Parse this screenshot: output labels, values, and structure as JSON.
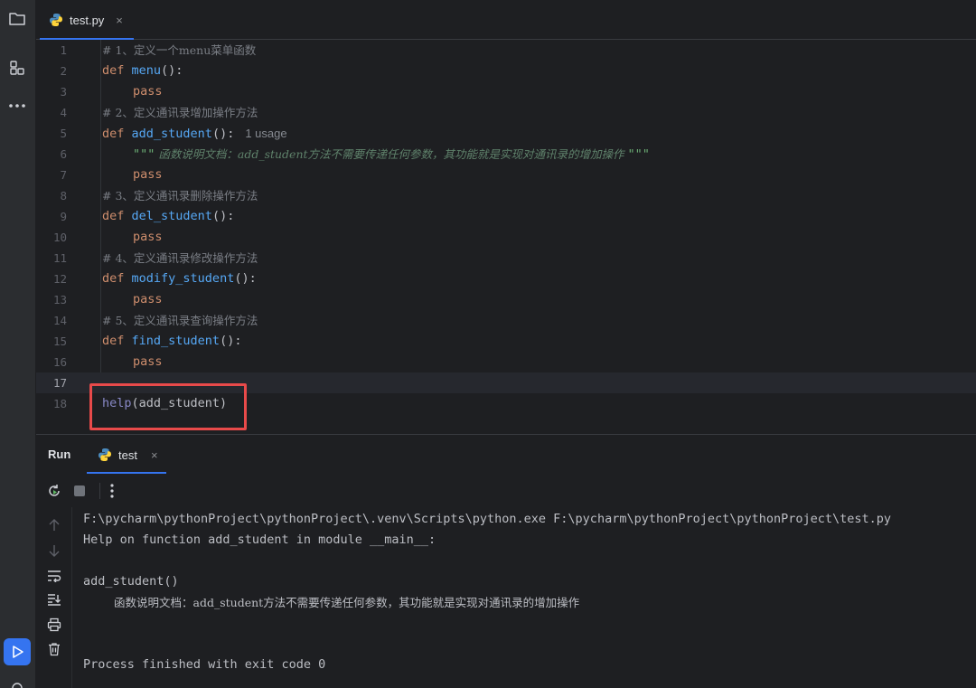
{
  "editor": {
    "tab": {
      "label": "test.py",
      "close": "×"
    },
    "lines": [
      {
        "n": "1",
        "t": "# 1、定义一个menu菜单函数"
      },
      {
        "n": "2",
        "kw": "def",
        "fn": "menu",
        "rest": "():"
      },
      {
        "n": "3",
        "kw": "pass"
      },
      {
        "n": "4",
        "t": "# 2、定义通讯录增加操作方法"
      },
      {
        "n": "5",
        "kw": "def",
        "fn": "add_student",
        "rest": "():",
        "hint": "1 usage"
      },
      {
        "n": "6",
        "q1": "\"\"\"",
        "doc": " 函数说明文档：add_student方法不需要传递任何参数，其功能就是实现对通讯录的增加操作 ",
        "q2": "\"\"\""
      },
      {
        "n": "7",
        "kw": "pass"
      },
      {
        "n": "8",
        "t": "# 3、定义通讯录删除操作方法"
      },
      {
        "n": "9",
        "kw": "def",
        "fn": "del_student",
        "rest": "():"
      },
      {
        "n": "10",
        "kw": "pass"
      },
      {
        "n": "11",
        "t": "# 4、定义通讯录修改操作方法"
      },
      {
        "n": "12",
        "kw": "def",
        "fn": "modify_student",
        "rest": "():"
      },
      {
        "n": "13",
        "kw": "pass"
      },
      {
        "n": "14",
        "t": "# 5、定义通讯录查询操作方法"
      },
      {
        "n": "15",
        "kw": "def",
        "fn": "find_student",
        "rest": "():"
      },
      {
        "n": "16",
        "kw": "pass"
      },
      {
        "n": "17"
      },
      {
        "n": "18",
        "call": "help",
        "args": "(add_student)"
      }
    ]
  },
  "run": {
    "title": "Run",
    "tab_label": "test",
    "tab_close": "×",
    "console": {
      "l1": "F:\\pycharm\\pythonProject\\pythonProject\\.venv\\Scripts\\python.exe F:\\pycharm\\pythonProject\\pythonProject\\test.py",
      "l2": "Help on function add_student in module __main__:",
      "l3": "add_student()",
      "l4": "函数说明文档：add_student方法不需要传递任何参数，其功能就是实现对通讯录的增加操作",
      "l5": "Process finished with exit code 0"
    }
  },
  "colors": {
    "accent": "#3574f0",
    "highlight_box": "#e84a4a",
    "keyword": "#cf8e6d",
    "function": "#56a8f5"
  },
  "icons": [
    "folder-icon",
    "structure-icon",
    "more-icon",
    "run-icon",
    "python-file-icon",
    "rerun-icon",
    "stop-icon",
    "menu-icon",
    "arrow-up-icon",
    "arrow-down-icon",
    "soft-wrap-icon",
    "scroll-to-end-icon",
    "print-icon",
    "trash-icon",
    "close-icon"
  ]
}
